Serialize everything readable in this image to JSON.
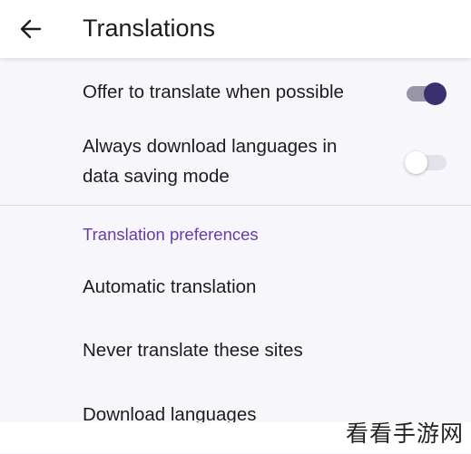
{
  "header": {
    "title": "Translations",
    "back_icon": "arrow-left-icon"
  },
  "toggles": [
    {
      "label": "Offer to translate when possible",
      "state": "on"
    },
    {
      "label_lines": [
        "Always download languages in",
        "data saving mode"
      ],
      "state": "off"
    }
  ],
  "section": {
    "title": "Translation preferences",
    "items": [
      {
        "label": "Automatic translation"
      },
      {
        "label": "Never translate these sites"
      },
      {
        "label": "Download languages"
      }
    ]
  },
  "watermark": {
    "text": "看看手游网"
  },
  "colors": {
    "accent": "#6a3aa7",
    "toggle_on_thumb": "#3b2f6e",
    "toggle_on_track": "#9795a8",
    "background": "#f7f6fb",
    "app_bar": "#ffffff"
  }
}
